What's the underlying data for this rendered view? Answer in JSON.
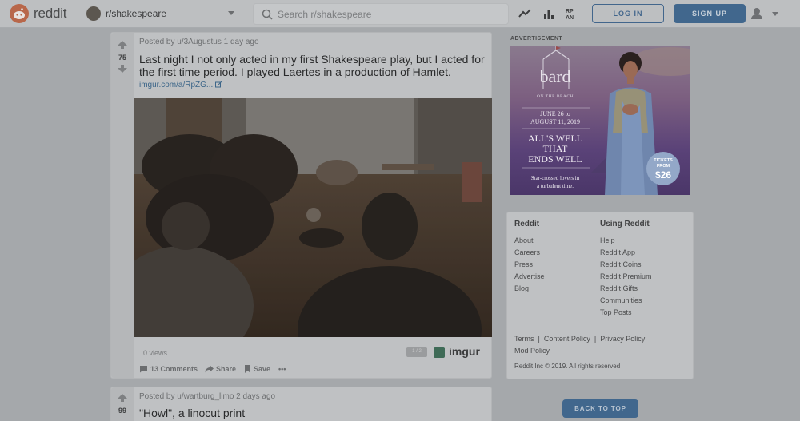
{
  "header": {
    "logo_text": "reddit",
    "community": "r/shakespeare",
    "search_placeholder": "Search r/shakespeare",
    "login_label": "LOG IN",
    "signup_label": "SIGN UP"
  },
  "posts": [
    {
      "score": "75",
      "meta": "Posted by u/3Augustus 1 day ago",
      "title": "Last night I not only acted in my first Shakespeare play, but I acted for the first time period. I played Laertes in a production of Hamlet.",
      "link_text": "imgur.com/a/RpZG...",
      "views": "0 views",
      "badge": "1 / 2",
      "host": "imgur",
      "comments": "13 Comments",
      "share": "Share",
      "save": "Save",
      "more": "•••"
    },
    {
      "score": "99",
      "meta": "Posted by u/wartburg_limo 2 days ago",
      "title": "\"Howl\", a linocut print"
    }
  ],
  "ad": {
    "label": "ADVERTISEMENT",
    "brand": "bard",
    "brand_sub": "ON THE BEACH",
    "dates_line1": "JUNE 26 to",
    "dates_line2": "AUGUST 11, 2019",
    "play_line1": "ALL'S WELL",
    "play_line2": "THAT",
    "play_line3": "ENDS WELL",
    "tagline1": "Star-crossed lovers in",
    "tagline2": "a turbulent time.",
    "ticket_label1": "TICKETS",
    "ticket_label2": "FROM",
    "ticket_price": "$26"
  },
  "footer": {
    "col1_title": "Reddit",
    "col1_links": [
      "About",
      "Careers",
      "Press",
      "Advertise",
      "Blog"
    ],
    "col2_title": "Using Reddit",
    "col2_links": [
      "Help",
      "Reddit App",
      "Reddit Coins",
      "Reddit Premium",
      "Reddit Gifts",
      "Communities",
      "Top Posts"
    ],
    "legal": [
      "Terms",
      "Content Policy",
      "Privacy Policy",
      "Mod Policy"
    ],
    "separator": "|",
    "copyright": "Reddit Inc © 2019. All rights reserved"
  },
  "back_to_top": "BACK TO TOP",
  "colors": {
    "overlay_background": "#a5a8ab",
    "accent": "#41678d",
    "upvote_orange": "#b8674a"
  }
}
